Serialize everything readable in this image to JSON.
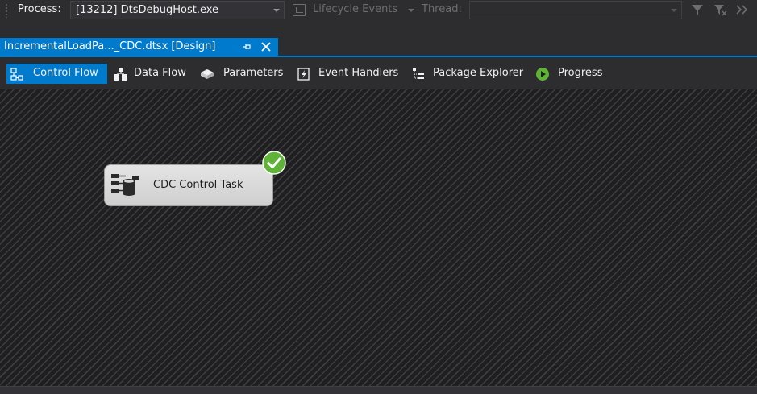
{
  "debugbar": {
    "process_label": "Process:",
    "process_value": "[13212] DtsDebugHost.exe",
    "lifecycle_label": "Lifecycle Events",
    "thread_label": "Thread:",
    "thread_value": ""
  },
  "document_tab": {
    "title": "IncrementalLoadPa..._CDC.dtsx [Design]",
    "pin_icon": "pin-icon",
    "close_icon": "close-icon"
  },
  "designer_tabs": [
    {
      "label": "Control Flow",
      "icon": "control-flow-icon",
      "active": true
    },
    {
      "label": "Data Flow",
      "icon": "data-flow-icon",
      "active": false
    },
    {
      "label": "Parameters",
      "icon": "parameters-icon",
      "active": false
    },
    {
      "label": "Event Handlers",
      "icon": "event-handlers-icon",
      "active": false
    },
    {
      "label": "Package Explorer",
      "icon": "package-explorer-icon",
      "active": false
    },
    {
      "label": "Progress",
      "icon": "progress-icon",
      "active": false
    }
  ],
  "canvas": {
    "tasks": [
      {
        "label": "CDC Control Task",
        "icon": "cdc-task-icon",
        "status": "success",
        "status_icon": "success-check-icon"
      }
    ]
  },
  "colors": {
    "accent": "#007acc",
    "background": "#2d2d30",
    "success": "#5fb336",
    "task_fill": "#d9d9d9"
  }
}
